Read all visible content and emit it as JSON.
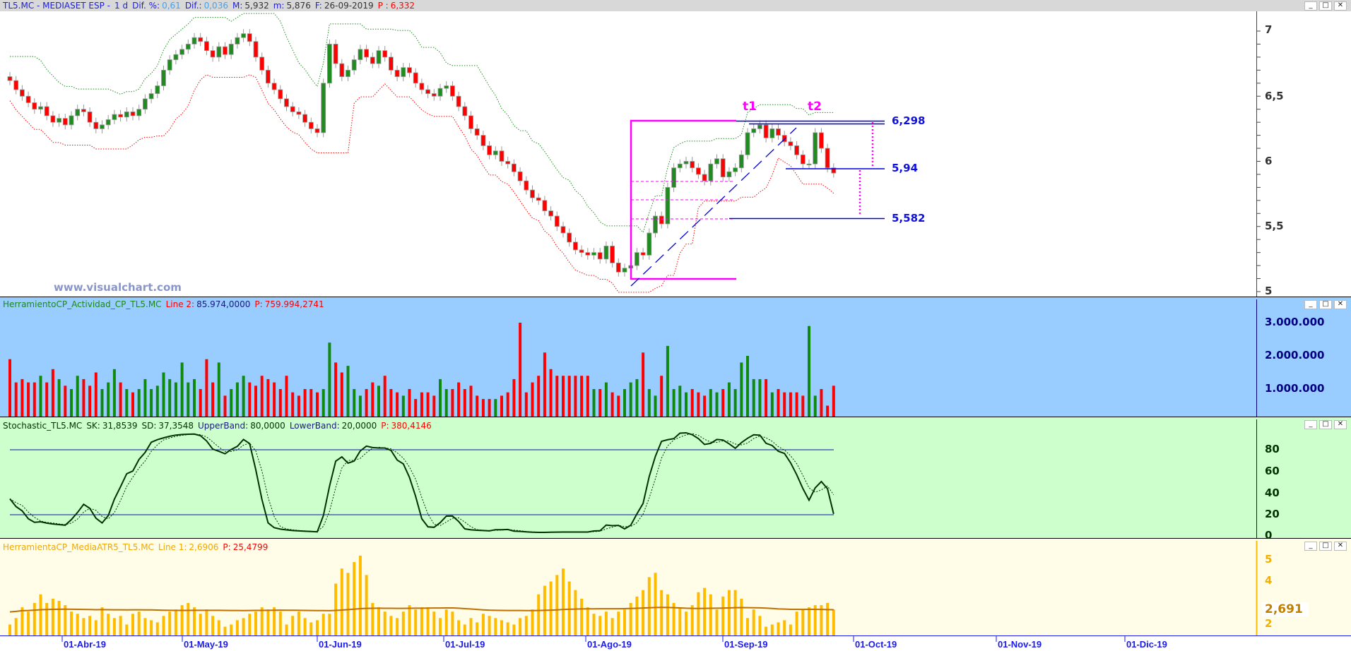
{
  "title_bar": {
    "symbol": "TL5.MC - MEDIASET ESP -",
    "period": "1 d",
    "dif_pct_label": "Dif. %:",
    "dif_pct": "0,61",
    "dif_label": "Dif.:",
    "dif": "0,036",
    "max_label": "M:",
    "max": "5,932",
    "min_label": "m:",
    "min": "5,876",
    "date_label": "F:",
    "date": "26-09-2019",
    "p_label": "P :",
    "p": "6,332"
  },
  "window_buttons": {
    "minimize": "_",
    "maximize": "□",
    "close": "✕"
  },
  "watermark": "www.visualchart.com",
  "price_pane": {
    "y_ticks": [
      "7",
      "6,5",
      "6",
      "5,5",
      "5"
    ],
    "levels": [
      "6,298",
      "5,94",
      "5,582"
    ],
    "tags": [
      "t1",
      "t2"
    ]
  },
  "volume_pane": {
    "name": "HerramientoCP_Actividad_CP_TL5.MC",
    "line_label": "Line 2:",
    "line_value": "85.974,0000",
    "p_label": "P:",
    "p_value": "759.994,2741",
    "y_ticks": [
      "3.000.000",
      "2.000.000",
      "1.000.000"
    ]
  },
  "stoch_pane": {
    "name": "Stochastic_TL5.MC",
    "sk_label": "SK:",
    "sk": "31,8539",
    "sd_label": "SD:",
    "sd": "37,3548",
    "upper_label": "UpperBand:",
    "upper": "80,0000",
    "lower_label": "LowerBand:",
    "lower": "20,0000",
    "p_label": "P:",
    "p": "380,4146",
    "y_ticks": [
      "80",
      "60",
      "40",
      "20",
      "0"
    ]
  },
  "atr_pane": {
    "name": "HerramientaCP_MediaATR5_TL5.MC",
    "line_label": "Line 1:",
    "line_value": "2,6906",
    "p_label": "P:",
    "p": "25,4799",
    "y_ticks": [
      "5",
      "4",
      "2"
    ],
    "current": "2,691"
  },
  "x_ticks": [
    "01-Abr-19",
    "01-May-19",
    "01-Jun-19",
    "01-Jul-19",
    "01-Ago-19",
    "01-Sep-19",
    "01-Oct-19",
    "01-Nov-19",
    "01-Dic-19"
  ],
  "colors": {
    "up": "#1e8c1e",
    "down": "#ff0000",
    "volume_bg": "#99ccff",
    "stoch_bg": "#ccffcc",
    "atr_bg": "#fffde8",
    "atr_bar": "#ffbb00",
    "annotation": "#ff00ff",
    "level": "#0000dd"
  },
  "chart_data": {
    "type": "candlestick",
    "y_range": [
      5,
      7.2
    ],
    "closes": [
      6.62,
      6.55,
      6.5,
      6.45,
      6.4,
      6.42,
      6.35,
      6.3,
      6.33,
      6.28,
      6.35,
      6.4,
      6.38,
      6.3,
      6.25,
      6.28,
      6.32,
      6.36,
      6.34,
      6.38,
      6.35,
      6.4,
      6.48,
      6.52,
      6.58,
      6.7,
      6.78,
      6.82,
      6.86,
      6.9,
      6.95,
      6.92,
      6.85,
      6.8,
      6.88,
      6.82,
      6.9,
      6.95,
      6.98,
      6.92,
      6.8,
      6.7,
      6.6,
      6.55,
      6.48,
      6.42,
      6.38,
      6.36,
      6.3,
      6.25,
      6.22,
      6.6,
      6.9,
      6.75,
      6.65,
      6.7,
      6.78,
      6.86,
      6.8,
      6.75,
      6.85,
      6.8,
      6.7,
      6.65,
      6.72,
      6.68,
      6.6,
      6.55,
      6.52,
      6.5,
      6.56,
      6.58,
      6.5,
      6.42,
      6.35,
      6.25,
      6.2,
      6.12,
      6.05,
      6.08,
      6.0,
      5.98,
      5.92,
      5.85,
      5.78,
      5.72,
      5.7,
      5.62,
      5.58,
      5.5,
      5.45,
      5.38,
      5.32,
      5.3,
      5.28,
      5.3,
      5.25,
      5.35,
      5.22,
      5.15,
      5.18,
      5.2,
      5.3,
      5.28,
      5.45,
      5.58,
      5.52,
      5.8,
      5.95,
      5.98,
      6.0,
      5.95,
      5.9,
      5.85,
      5.98,
      6.02,
      5.88,
      5.92,
      5.95,
      6.05,
      6.22,
      6.25,
      6.28,
      6.18,
      6.25,
      6.2,
      6.15,
      6.12,
      6.05,
      5.98,
      5.98,
      6.22,
      6.1,
      5.95,
      5.91
    ],
    "volume_millions": [
      1.9,
      1.2,
      1.3,
      1.2,
      1.2,
      1.4,
      1.2,
      1.6,
      1.3,
      1.1,
      1.0,
      1.4,
      1.3,
      1.1,
      1.5,
      1.0,
      1.2,
      1.6,
      1.2,
      1.0,
      0.9,
      1.0,
      1.3,
      1.0,
      1.1,
      1.5,
      1.3,
      1.2,
      1.8,
      1.2,
      1.3,
      1.0,
      1.9,
      1.2,
      1.8,
      0.8,
      1.0,
      1.2,
      1.4,
      1.2,
      1.1,
      1.4,
      1.3,
      1.2,
      1.0,
      1.4,
      0.9,
      0.8,
      1.0,
      1.0,
      0.9,
      1.0,
      2.4,
      1.8,
      1.5,
      1.7,
      1.0,
      0.8,
      1.0,
      1.2,
      1.1,
      1.4,
      1.0,
      0.9,
      0.8,
      1.0,
      0.7,
      0.9,
      0.9,
      0.8,
      1.3,
      1.0,
      1.0,
      1.2,
      1.0,
      1.1,
      0.8,
      0.7,
      0.7,
      0.7,
      0.8,
      0.9,
      1.3,
      3.0,
      0.9,
      1.2,
      1.4,
      2.1,
      1.6,
      1.4,
      1.4,
      1.4,
      1.4,
      1.4,
      1.4,
      1.0,
      1.0,
      1.2,
      0.9,
      0.8,
      1.0,
      1.2,
      1.3,
      2.1,
      1.0,
      0.8,
      1.4,
      2.3,
      1.0,
      1.1,
      0.9,
      1.0,
      0.9,
      0.8,
      1.0,
      0.9,
      1.0,
      1.2,
      1.0,
      1.8,
      2.0,
      1.3,
      1.3,
      1.3,
      0.9,
      1.0,
      0.9,
      0.9,
      0.9,
      0.8,
      2.9,
      0.8,
      1.0,
      0.5,
      1.1
    ],
    "atr": [
      2.0,
      2.3,
      2.8,
      2.6,
      3.0,
      3.4,
      3.0,
      3.2,
      3.1,
      2.9,
      2.6,
      2.5,
      2.3,
      2.4,
      2.2,
      2.8,
      2.5,
      2.3,
      2.4,
      2.0,
      2.5,
      2.6,
      2.3,
      2.2,
      2.1,
      2.4,
      2.6,
      2.7,
      2.9,
      3.0,
      2.8,
      2.5,
      2.7,
      2.4,
      2.2,
      1.9,
      2.0,
      2.2,
      2.3,
      2.5,
      2.6,
      2.8,
      2.7,
      2.8,
      2.6,
      2.0,
      2.4,
      2.6,
      2.3,
      2.1,
      2.2,
      2.5,
      2.5,
      3.9,
      4.6,
      4.4,
      4.9,
      5.2,
      4.3,
      3.0,
      2.8,
      2.6,
      2.4,
      2.3,
      2.6,
      2.9,
      2.7,
      2.8,
      2.8,
      2.6,
      2.3,
      2.7,
      2.6,
      2.2,
      2.0,
      2.3,
      2.1,
      2.5,
      2.4,
      2.3,
      2.2,
      2.1,
      2.0,
      2.3,
      2.4,
      2.7,
      3.4,
      3.8,
      4.0,
      4.3,
      4.6,
      4.0,
      3.6,
      3.2,
      2.8,
      2.5,
      2.4,
      2.6,
      2.3,
      2.6,
      2.7,
      3.0,
      3.3,
      3.6,
      4.2,
      4.4,
      3.6,
      3.4,
      3.0,
      2.8,
      2.6,
      2.9,
      3.5,
      3.7,
      3.4,
      2.7,
      3.3,
      3.6,
      3.6,
      3.2,
      2.3,
      2.7,
      2.4,
      1.9,
      2.0,
      2.1,
      2.2,
      2.0,
      2.6,
      2.7,
      2.8,
      2.9,
      2.9,
      3.0,
      2.7
    ],
    "atr_mean": 2.6906,
    "stoch_bands": [
      80,
      20
    ]
  }
}
